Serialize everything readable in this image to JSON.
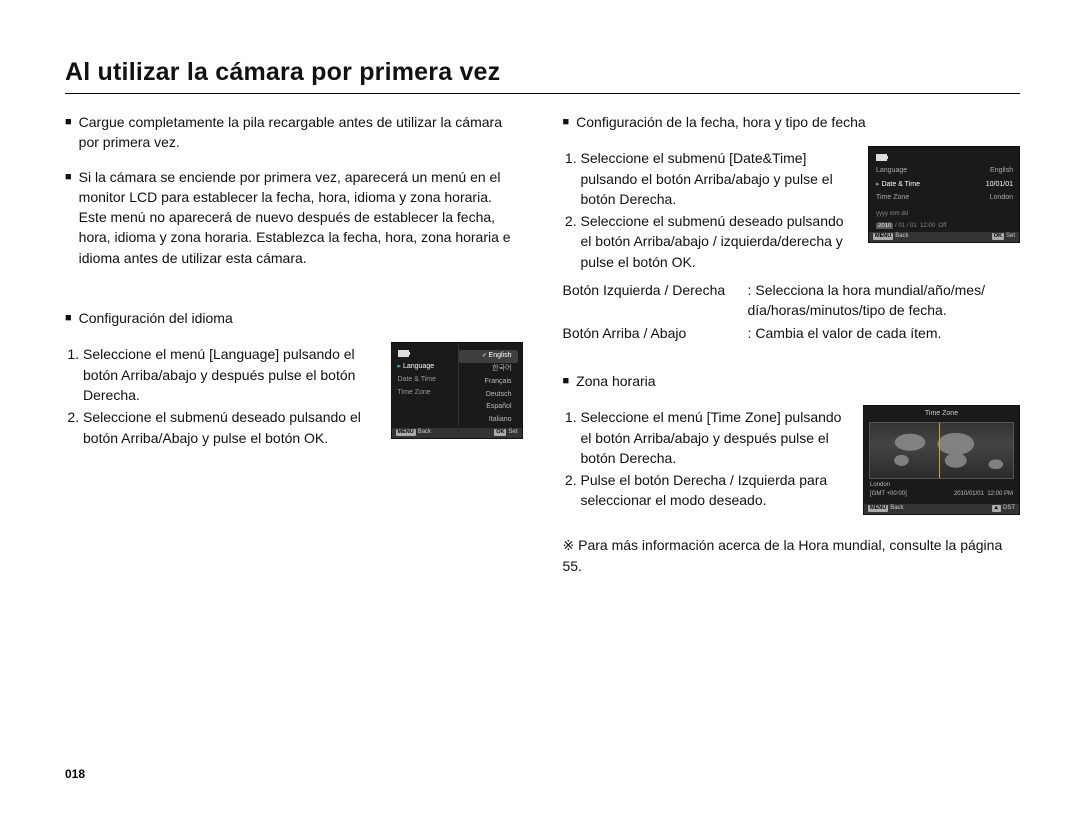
{
  "title": "Al utilizar la cámara por primera vez",
  "page_number": "018",
  "left": {
    "intro1": "Cargue completamente la pila recargable antes de utilizar la cámara por primera vez.",
    "intro2": "Si la cámara se enciende por primera vez, aparecerá un menú en el monitor LCD para establecer la fecha, hora, idioma y zona horaria. Este menú no aparecerá de nuevo después de establecer la fecha, hora, idioma y zona horaria. Establezca la fecha, hora, zona horaria e idioma antes de utilizar esta cámara.",
    "lang_header": "Configuración del idioma",
    "lang_step1": "Seleccione el menú [Language] pulsando el botón Arriba/abajo y después pulse el botón Derecha.",
    "lang_step2": "Seleccione el submenú deseado pulsando el botón Arriba/Abajo y pulse el botón OK."
  },
  "right": {
    "dt_header": "Configuración de la fecha, hora y tipo de fecha",
    "dt_step1": "Seleccione el submenú [Date&Time] pulsando el botón Arriba/abajo y pulse el botón Derecha.",
    "dt_step2": "Seleccione el submenú deseado pulsando el botón Arriba/abajo / izquierda/derecha y pulse el botón OK.",
    "lr_key": "Botón Izquierda / Derecha",
    "lr_val": "Selecciona la hora mundial/año/mes/ día/horas/minutos/tipo de fecha.",
    "ud_key": "Botón Arriba / Abajo",
    "ud_val": "Cambia el valor de cada ítem.",
    "tz_header": "Zona horaria",
    "tz_step1": "Seleccione el menú [Time Zone] pulsando el botón Arriba/abajo y después pulse el botón Derecha.",
    "tz_step2": "Pulse el botón Derecha / Izquierda para seleccionar el modo deseado.",
    "note": "※ Para más información acerca de la Hora mundial, consulte la página 55."
  },
  "lcd_lang": {
    "menu_items": {
      "a": "Language",
      "b": "Date & Time",
      "c": "Time Zone"
    },
    "options": {
      "o1": "English",
      "o2": "한국어",
      "o3": "Français",
      "o4": "Deutsch",
      "o5": "Español",
      "o6": "Italiano"
    },
    "back_tag": "MENU",
    "back": "Back",
    "ok_tag": "OK",
    "ok": "Set"
  },
  "lcd_dt": {
    "rows": {
      "r1k": "Language",
      "r1v": "English",
      "r2k": "Date & Time",
      "r2v": "10/01/01",
      "r3k": "Time Zone",
      "r3v": "London"
    },
    "fmt": "yyyy mm dd",
    "edit_year": "2010",
    "edit_sep1": " / 01 / 01",
    "edit_time": "12:00",
    "edit_off": "Off",
    "back_tag": "MENU",
    "back": "Back",
    "ok_tag": "OK",
    "ok": "Set"
  },
  "lcd_tz": {
    "title": "Time Zone",
    "city": "London",
    "gmt": "[GMT +00:00]",
    "date": "2010/01/01",
    "time": "12:00 PM",
    "back_tag": "MENU",
    "back": "Back",
    "dst_tag": "▲",
    "dst": "DST"
  }
}
